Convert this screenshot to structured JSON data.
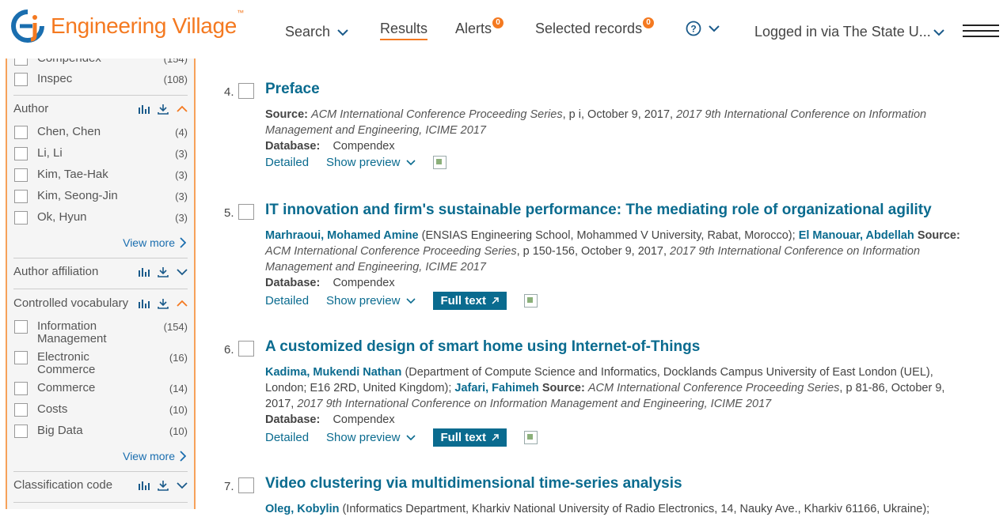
{
  "header": {
    "logo_text": "Engineering Village",
    "logo_tm": "™",
    "nav": {
      "search": "Search",
      "results": "Results",
      "alerts": "Alerts",
      "alerts_count": "0",
      "selected": "Selected records",
      "selected_count": "0",
      "help_icon": "?",
      "login": "Logged in via The State U..."
    }
  },
  "sidebar": {
    "database_items": [
      {
        "label": "Compendex",
        "count": "(154)"
      },
      {
        "label": "Inspec",
        "count": "(108)"
      }
    ],
    "author": {
      "title": "Author",
      "items": [
        {
          "label": "Chen, Chen",
          "count": "(4)"
        },
        {
          "label": "Li, Li",
          "count": "(3)"
        },
        {
          "label": "Kim, Tae-Hak",
          "count": "(3)"
        },
        {
          "label": "Kim, Seong-Jin",
          "count": "(3)"
        },
        {
          "label": "Ok, Hyun",
          "count": "(3)"
        }
      ],
      "view_more": "View more"
    },
    "affiliation": {
      "title": "Author affiliation"
    },
    "controlled": {
      "title": "Controlled vocabulary",
      "items": [
        {
          "label": "Information Management",
          "count": "(154)"
        },
        {
          "label": "Electronic Commerce",
          "count": "(16)"
        },
        {
          "label": "Commerce",
          "count": "(14)"
        },
        {
          "label": "Costs",
          "count": "(10)"
        },
        {
          "label": "Big Data",
          "count": "(10)"
        }
      ],
      "view_more": "View more"
    },
    "classification": {
      "title": "Classification code"
    }
  },
  "results": {
    "labels": {
      "source": "Source:",
      "database": "Database:",
      "detailed": "Detailed",
      "show_preview": "Show preview",
      "full_text": "Full text"
    },
    "items": [
      {
        "num": "4.",
        "title": "Preface",
        "source_text": "ACM International Conference Proceeding Series",
        "source_rest": ", p i, October 9, 2017, ",
        "source_conf": "2017 9th International Conference on Information Management and Engineering, ICIME 2017",
        "database": "Compendex"
      },
      {
        "num": "5.",
        "title": "IT innovation and firm's sustainable performance: The mediating role of organizational agility",
        "author1": "Marhraoui, Mohamed Amine",
        "aff1": " (ENSIAS Engineering School, Mohammed V University, Rabat, Morocco); ",
        "author2": "El Manouar, Abdellah",
        "source_text": "ACM International Conference Proceeding Series",
        "source_rest": ", p 150-156, October 9, 2017, ",
        "source_conf": "2017 9th International Conference on Information Management and Engineering, ICIME 2017",
        "database": "Compendex"
      },
      {
        "num": "6.",
        "title": "A customized design of smart home using Internet-of-Things",
        "author1": "Kadima, Mukendi Nathan",
        "aff1": " (Department of Compute Science and Informatics, Docklands Campus University of East London (UEL), London; E16 2RD, United Kingdom); ",
        "author2": "Jafari, Fahimeh",
        "source_text": "ACM International Conference Proceeding Series",
        "source_rest": ", p 81-86, October 9, 2017, ",
        "source_conf": "2017 9th International Conference on Information Management and Engineering, ICIME 2017",
        "database": "Compendex"
      },
      {
        "num": "7.",
        "title": "Video clustering via multidimensional time-series analysis",
        "author1": "Oleg, Kobylin",
        "aff1": " (Informatics Department, Kharkiv National University of Radio Electronics, 14, Nauky Ave., Kharkiv 61166, Ukraine);"
      }
    ]
  },
  "colors": {
    "accent": "#f47920",
    "link": "#0a6b8f",
    "facet_link": "#1a6eaf"
  }
}
